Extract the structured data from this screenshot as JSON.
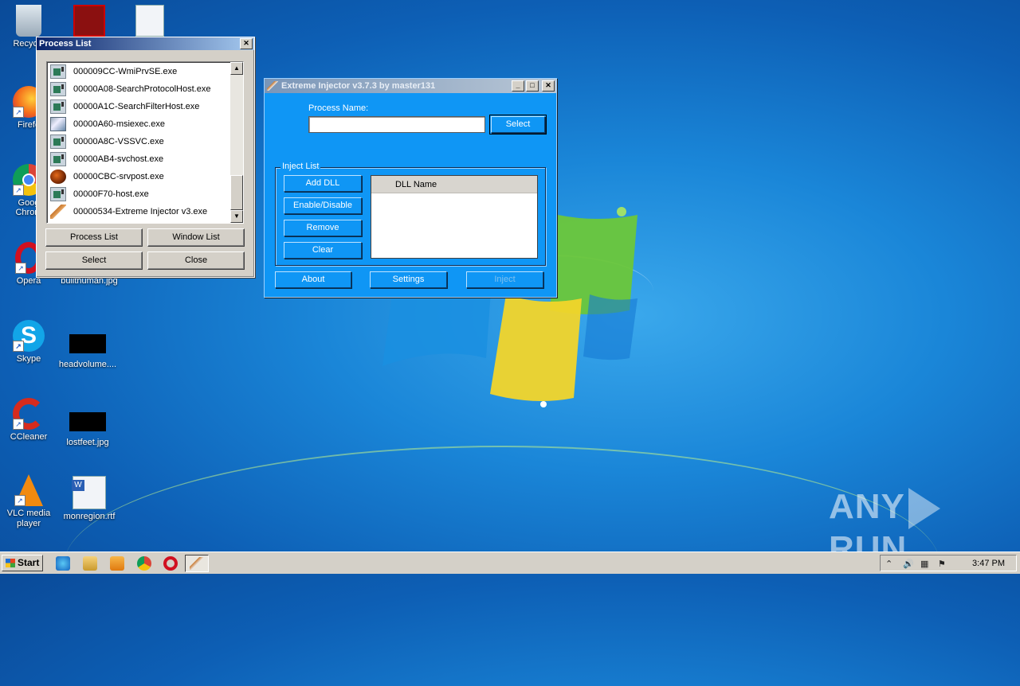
{
  "desktop": {
    "icons": [
      {
        "label": "Recycle"
      },
      {
        "label": "Firefo"
      },
      {
        "label": "Goog Chrom"
      },
      {
        "label": "Opera"
      },
      {
        "label": "Skype"
      },
      {
        "label": "CCleaner"
      },
      {
        "label": "VLC media player"
      },
      {
        "label": "builthuman.jpg"
      },
      {
        "label": "headvolume...."
      },
      {
        "label": "lostfeet.jpg"
      },
      {
        "label": "monregion.rtf"
      }
    ]
  },
  "process_list": {
    "title": "Process List",
    "items": [
      {
        "label": "000009CC-WmiPrvSE.exe",
        "icon": "generic-app-icon"
      },
      {
        "label": "00000A08-SearchProtocolHost.exe",
        "icon": "generic-app-icon"
      },
      {
        "label": "00000A1C-SearchFilterHost.exe",
        "icon": "generic-app-icon"
      },
      {
        "label": "00000A60-msiexec.exe",
        "icon": "installer-icon"
      },
      {
        "label": "00000A8C-VSSVC.exe",
        "icon": "generic-app-icon"
      },
      {
        "label": "00000AB4-svchost.exe",
        "icon": "generic-app-icon"
      },
      {
        "label": "00000CBC-srvpost.exe",
        "icon": "srvpost-icon"
      },
      {
        "label": "00000F70-host.exe",
        "icon": "generic-app-icon"
      },
      {
        "label": "00000534-Extreme Injector v3.exe",
        "icon": "injector-icon"
      }
    ],
    "buttons": {
      "process_list": "Process List",
      "window_list": "Window List",
      "select": "Select",
      "close": "Close"
    }
  },
  "injector": {
    "title": "Extreme Injector v3.7.3 by master131",
    "process_name_label": "Process Name:",
    "process_name_value": "",
    "select_label": "Select",
    "inject_list_label": "Inject List",
    "add_dll": "Add DLL",
    "enable_disable": "Enable/Disable",
    "remove": "Remove",
    "clear": "Clear",
    "dll_column": "DLL Name",
    "about": "About",
    "settings": "Settings",
    "inject": "Inject"
  },
  "watermark": {
    "left": "ANY",
    "right": "RUN"
  },
  "taskbar": {
    "start_label": "Start",
    "clock": "3:47 PM"
  },
  "colors": {
    "injector_bg": "#0f96f5",
    "classic_face": "#d4d0c8",
    "active_title": "#0a246a"
  }
}
